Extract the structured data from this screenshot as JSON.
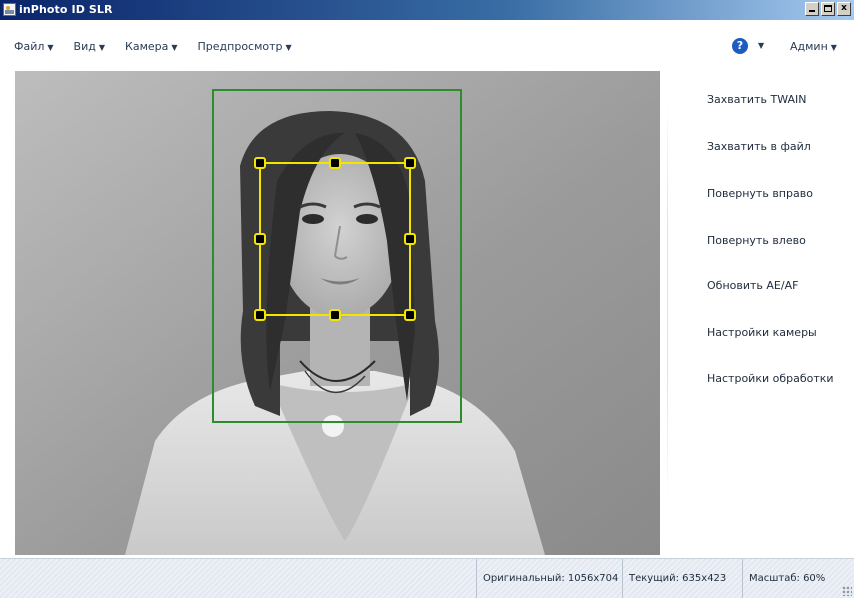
{
  "window": {
    "title": "inPhoto ID SLR",
    "minimize_label": "_",
    "maximize_label": "",
    "close_label": "x"
  },
  "menu": {
    "items": [
      {
        "label": "Файл"
      },
      {
        "label": "Вид"
      },
      {
        "label": "Камера"
      },
      {
        "label": "Предпросмотр"
      }
    ],
    "help_icon": "?",
    "admin_label": "Админ"
  },
  "actions": [
    {
      "label": "Захватить TWAIN"
    },
    {
      "label": "Захватить в файл"
    },
    {
      "label": "Повернуть вправо"
    },
    {
      "label": "Повернуть влево"
    },
    {
      "label": "Обновить AE/AF"
    },
    {
      "label": "Настройки камеры"
    },
    {
      "label": "Настройки обработки"
    }
  ],
  "status": {
    "original": "Оригинальный: 1056x704",
    "current": "Текущий: 635x423",
    "zoom": "Масштаб: 60%"
  },
  "colors": {
    "crop_frame": "#2e8b2e",
    "face_box": "#f2e600",
    "handle": "#000000"
  }
}
